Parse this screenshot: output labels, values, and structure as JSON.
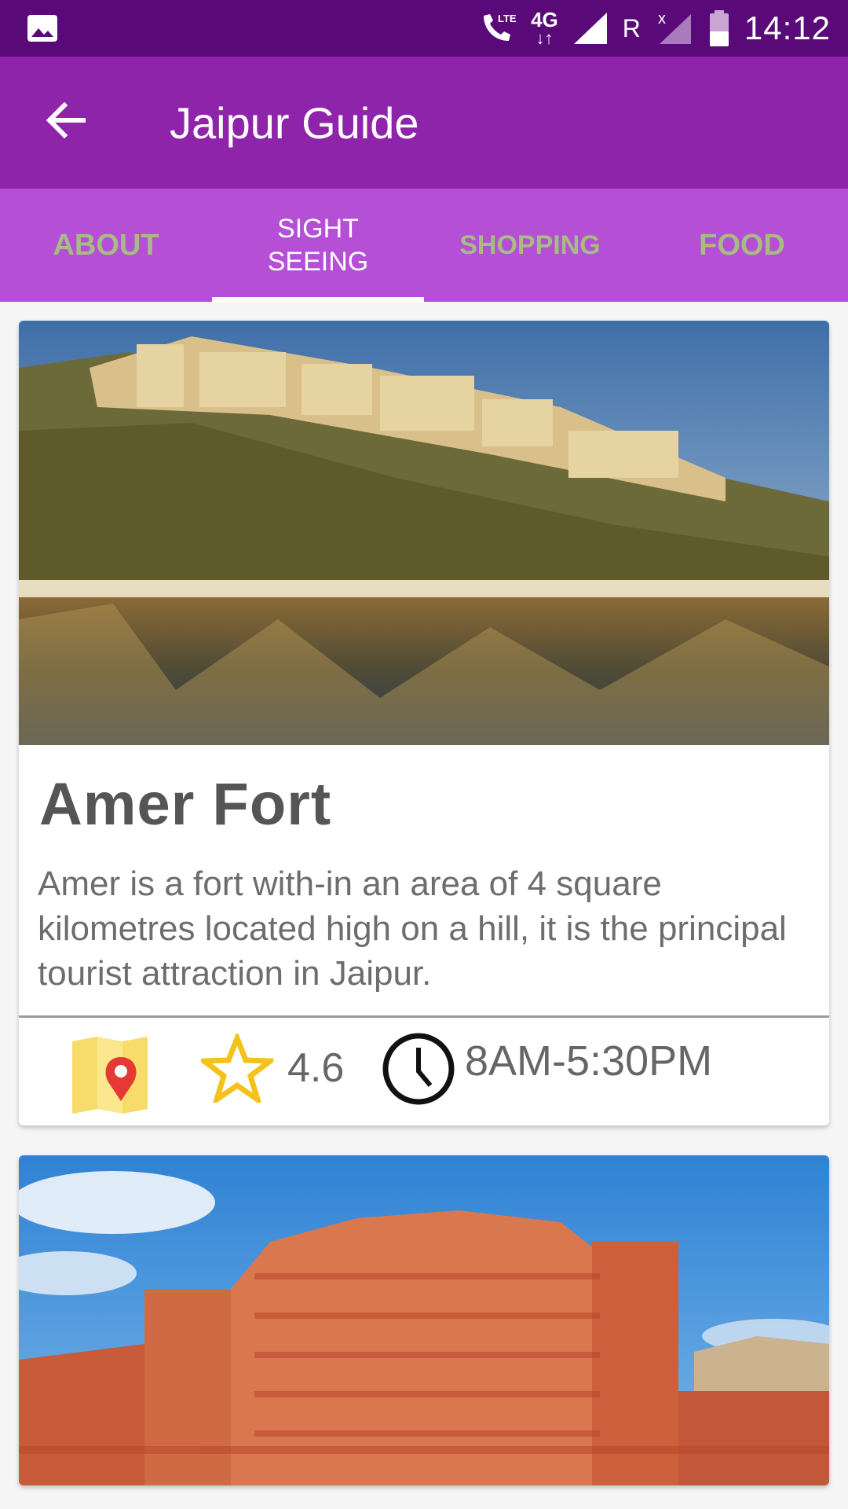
{
  "status_bar": {
    "time": "14:12",
    "network_type": "4G",
    "lte_badge": "LTE",
    "roaming": "R"
  },
  "toolbar": {
    "title": "Jaipur Guide"
  },
  "tabs": [
    {
      "label": "ABOUT",
      "active": false
    },
    {
      "label": "SIGHT\nSEEING",
      "active": true
    },
    {
      "label": "SHOPPING",
      "active": false
    },
    {
      "label": "FOOD",
      "active": false
    }
  ],
  "places": [
    {
      "name": "Amer Fort",
      "description": "Amer is a fort with-in an area of 4 square kilometres located high on a hill, it is the principal tourist attraction in Jaipur.",
      "rating": "4.6",
      "hours": "8AM-5:30PM"
    }
  ],
  "colors": {
    "status_bar": "#5a0a78",
    "toolbar": "#8e24aa",
    "tab_bar": "#b44fd6",
    "tab_inactive_text": "#a6bc83"
  },
  "icons": {
    "back": "arrow-left",
    "map": "map-pin",
    "rating": "star-outline",
    "hours": "clock"
  }
}
